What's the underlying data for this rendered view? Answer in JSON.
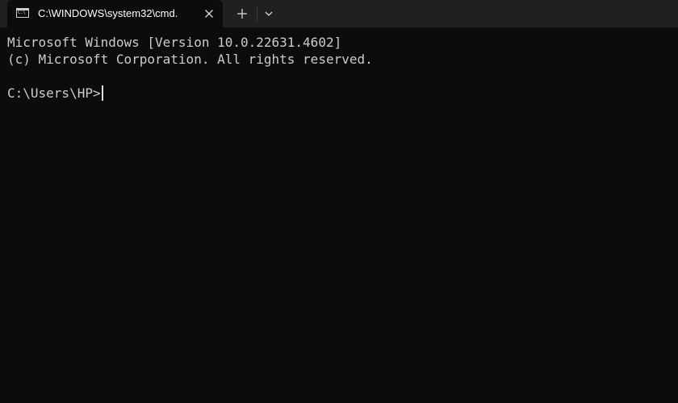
{
  "tab": {
    "icon": "command-prompt-icon",
    "icon_text": "C:\\",
    "title": "C:\\WINDOWS\\system32\\cmd.",
    "close_icon": "close-icon"
  },
  "tabbar": {
    "new_tab_icon": "plus-icon",
    "dropdown_icon": "chevron-down-icon"
  },
  "terminal": {
    "lines": [
      "Microsoft Windows [Version 10.0.22631.4602]",
      "(c) Microsoft Corporation. All rights reserved.",
      ""
    ],
    "prompt": "C:\\Users\\HP>"
  },
  "colors": {
    "background": "#0c0c0c",
    "tabbar": "#202020",
    "text": "#cccccc"
  }
}
